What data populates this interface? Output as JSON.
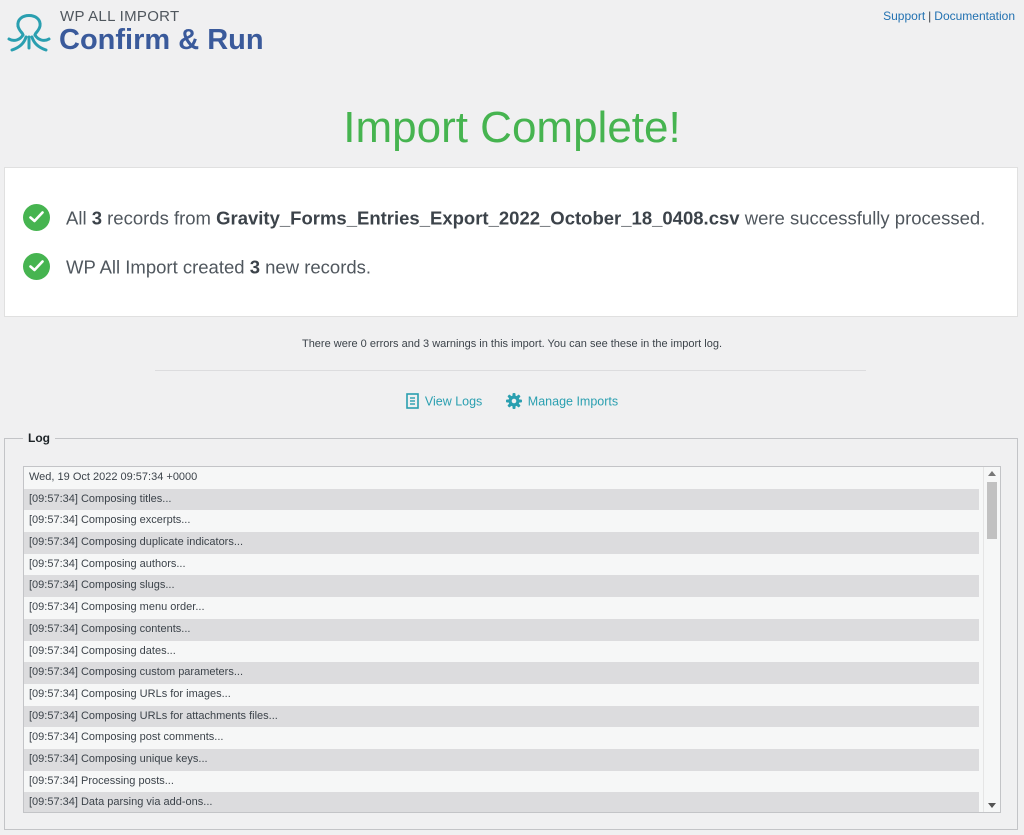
{
  "header": {
    "brand_small": "WP ALL IMPORT",
    "brand_title": "Confirm & Run",
    "support_label": "Support",
    "separator": "|",
    "documentation_label": "Documentation"
  },
  "title": "Import Complete!",
  "results": {
    "line1": {
      "prefix": "All ",
      "count": "3",
      "middle": " records from ",
      "filename": "Gravity_Forms_Entries_Export_2022_October_18_0408.csv",
      "suffix": " were successfully processed."
    },
    "line2": {
      "prefix": "WP All Import created ",
      "count": "3",
      "suffix": " new records."
    }
  },
  "summary": "There were 0 errors and 3 warnings in this import. You can see these in the import log.",
  "actions": {
    "view_logs": "View Logs",
    "manage_imports": "Manage Imports"
  },
  "log": {
    "legend": "Log",
    "rows": [
      "Wed, 19 Oct 2022 09:57:34 +0000",
      "[09:57:34] Composing titles...",
      "[09:57:34] Composing excerpts...",
      "[09:57:34] Composing duplicate indicators...",
      "[09:57:34] Composing authors...",
      "[09:57:34] Composing slugs...",
      "[09:57:34] Composing menu order...",
      "[09:57:34] Composing contents...",
      "[09:57:34] Composing dates...",
      "[09:57:34] Composing custom parameters...",
      "[09:57:34] Composing URLs for images...",
      "[09:57:34] Composing URLs for attachments files...",
      "[09:57:34] Composing post comments...",
      "[09:57:34] Composing unique keys...",
      "[09:57:34] Processing posts...",
      "[09:57:34] Data parsing via add-ons..."
    ]
  },
  "colors": {
    "success": "#46b450",
    "brand": "#3a5a9b",
    "link": "#2271b1",
    "action": "#2a9fb0"
  }
}
